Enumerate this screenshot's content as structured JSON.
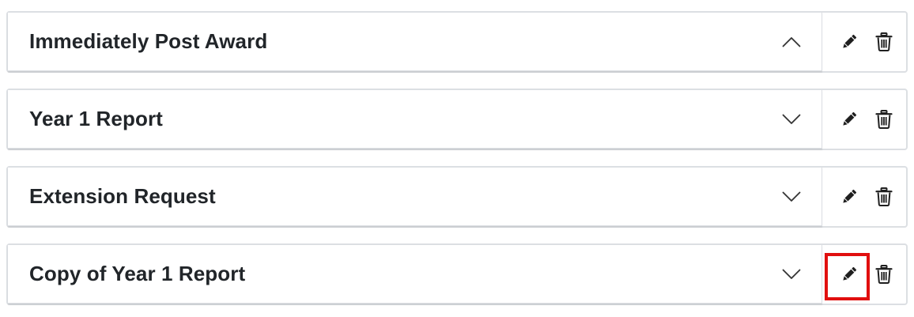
{
  "accordion": {
    "items": [
      {
        "title": "Immediately Post Award",
        "expanded": true,
        "chevron_icon": "chevron-up-icon"
      },
      {
        "title": "Year 1 Report",
        "expanded": false,
        "chevron_icon": "chevron-down-icon"
      },
      {
        "title": "Extension Request",
        "expanded": false,
        "chevron_icon": "chevron-down-icon"
      },
      {
        "title": "Copy of Year 1 Report",
        "expanded": false,
        "chevron_icon": "chevron-down-icon"
      }
    ]
  },
  "actions": {
    "edit_icon": "pencil-icon",
    "delete_icon": "trash-icon"
  },
  "highlight": {
    "target": "row-4 edit button",
    "color": "#e10f0f"
  },
  "colors": {
    "text": "#212529",
    "border": "#dcdfe3"
  }
}
